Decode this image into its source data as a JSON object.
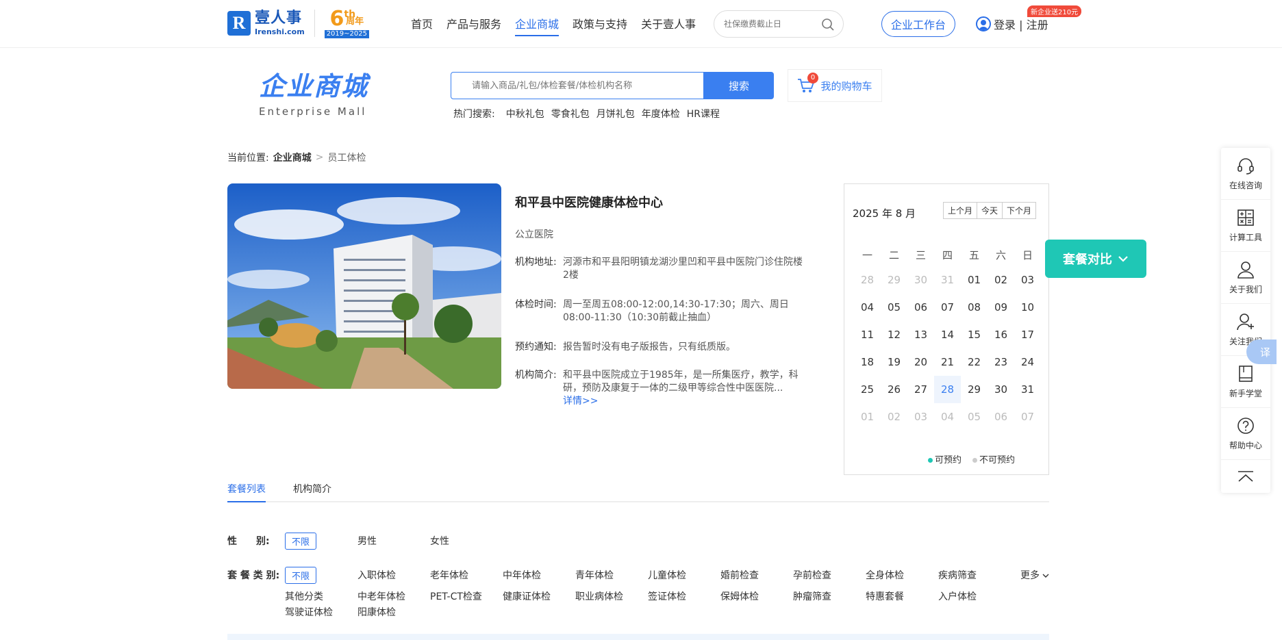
{
  "header": {
    "logo_cn": "壹人事",
    "logo_en": "Irenshi.com",
    "anniversary_num": "6",
    "anniversary_suffix": "th",
    "anniversary_label": "周年",
    "anniversary_years": "2019~2025",
    "nav": [
      "首页",
      "产品与服务",
      "企业商城",
      "政策与支持",
      "关于壹人事"
    ],
    "nav_active": "企业商城",
    "search_placeholder": "社保缴费截止日",
    "workbench": "企业工作台",
    "login": "登录 | 注册",
    "promo": "新企业送210元"
  },
  "mall": {
    "title_cn": "企业商城",
    "title_en": "Enterprise Mall",
    "search_placeholder": "请输入商品/礼包/体检套餐/体检机构名称",
    "search_button": "搜索",
    "cart_label": "我的购物车",
    "cart_count": "0",
    "hot_label": "热门搜索:",
    "hot_items": [
      "中秋礼包",
      "零食礼包",
      "月饼礼包",
      "年度体检",
      "HR课程"
    ]
  },
  "breadcrumb": {
    "prefix": "当前位置:",
    "level1": "企业商城",
    "sep": ">",
    "current": "员工体检"
  },
  "institution": {
    "name": "和平县中医院健康体检中心",
    "type": "公立医院",
    "address_label": "机构地址:",
    "address": "河源市和平县阳明镇龙湖沙里凹和平县中医院门诊住院楼2楼",
    "hours_label": "体检时间:",
    "hours": "周一至周五08:00-12:00,14:30-17:30；周六、周日08:00-11:30（10:30前截止抽血）",
    "notice_label": "预约通知:",
    "notice": "报告暂时没有电子版报告，只有纸质版。",
    "intro_label": "机构简介:",
    "intro": "和平县中医院成立于1985年，是一所集医疗，教学，科研，预防及康复于一体的二级甲等综合性中医医院...",
    "details_link": "详情>>"
  },
  "calendar": {
    "month_label": "2025 年 8 月",
    "prev": "上个月",
    "today": "今天",
    "next": "下个月",
    "weekdays": [
      "一",
      "二",
      "三",
      "四",
      "五",
      "六",
      "日"
    ],
    "weeks": [
      [
        "28",
        "29",
        "30",
        "31",
        "01",
        "02",
        "03"
      ],
      [
        "04",
        "05",
        "06",
        "07",
        "08",
        "09",
        "10"
      ],
      [
        "11",
        "12",
        "13",
        "14",
        "15",
        "16",
        "17"
      ],
      [
        "18",
        "19",
        "20",
        "21",
        "22",
        "23",
        "24"
      ],
      [
        "25",
        "26",
        "27",
        "28",
        "29",
        "30",
        "31"
      ],
      [
        "01",
        "02",
        "03",
        "04",
        "05",
        "06",
        "07"
      ]
    ],
    "today_date": "28",
    "legend_available": "可预约",
    "legend_unavailable": "不可预约",
    "available_color": "#1fc7b5",
    "unavailable_color": "#cccccc"
  },
  "compare_button": "套餐对比",
  "float_toolbar": [
    "在线咨询",
    "计算工具",
    "关于我们",
    "关注我们",
    "新手学堂",
    "帮助中心"
  ],
  "translate": "译",
  "tabs": [
    "套餐列表",
    "机构简介"
  ],
  "tab_active": "套餐列表",
  "filters": {
    "gender_label": "性　　别:",
    "gender_options": [
      "不限",
      "男性",
      "女性"
    ],
    "category_label": "套 餐 类 别:",
    "category_options": [
      "不限",
      "入职体检",
      "老年体检",
      "中年体检",
      "青年体检",
      "儿童体检",
      "婚前检查",
      "孕前检查",
      "全身体检",
      "疾病筛查",
      "其他分类",
      "中老年体检",
      "PET-CT检查",
      "健康证体检",
      "职业病体检",
      "签证体检",
      "保姆体检",
      "肿瘤筛查",
      "特惠套餐",
      "入户体检",
      "驾驶证体检",
      "阳康体检"
    ],
    "more": "更多"
  }
}
